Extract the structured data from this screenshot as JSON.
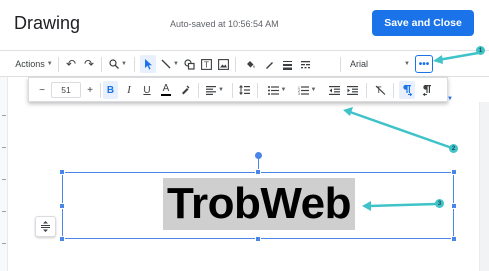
{
  "header": {
    "title": "Drawing",
    "autosave": "Auto-saved at 10:56:54 AM",
    "save_label": "Save and Close"
  },
  "toolbar": {
    "actions_label": "Actions",
    "font_name": "Arial",
    "more_label": "•••",
    "icons": [
      "undo-icon",
      "redo-icon",
      "zoom-icon",
      "select-icon",
      "line-icon",
      "shape-icon",
      "textbox-icon",
      "image-icon",
      "fill-color-icon",
      "line-color-icon",
      "line-weight-icon",
      "line-dash-icon"
    ]
  },
  "format_toolbar": {
    "minus": "−",
    "font_size": "51",
    "plus": "+",
    "bold": "B",
    "italic": "I",
    "underline": "U",
    "text_color": "A",
    "icons": [
      "highlight-icon",
      "align-icon",
      "line-spacing-icon",
      "bulleted-list-icon",
      "numbered-list-icon",
      "decrease-indent-icon",
      "increase-indent-icon",
      "clear-formatting-icon",
      "ltr-icon",
      "rtl-icon"
    ]
  },
  "canvas": {
    "text": "TrobWeb"
  },
  "annotations": {
    "marker_1": "1",
    "marker_2": "2",
    "marker_3": "3",
    "color": "#3fc3c9"
  },
  "colors": {
    "accent": "#1a73e8",
    "selection": "#4a86e8"
  }
}
